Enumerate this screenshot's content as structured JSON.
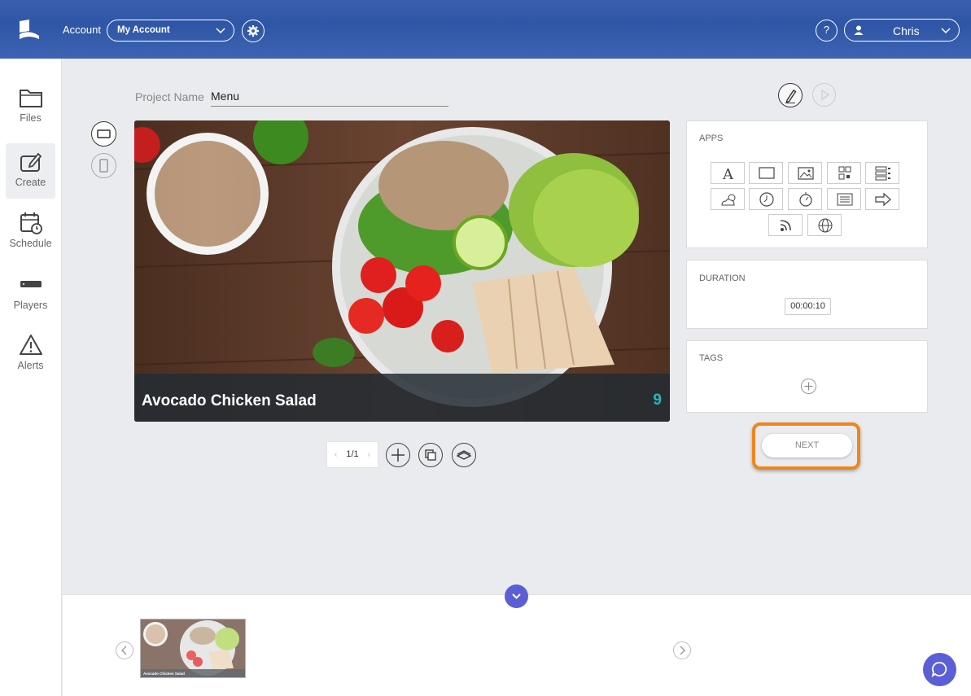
{
  "header": {
    "account_label": "Account",
    "account_value": "My Account",
    "help_label": "?",
    "user_name": "Chris"
  },
  "sidebar": {
    "items": [
      {
        "label": "Files",
        "icon": "folder-icon"
      },
      {
        "label": "Create",
        "icon": "create-icon",
        "active": true
      },
      {
        "label": "Schedule",
        "icon": "calendar-clock-icon"
      },
      {
        "label": "Players",
        "icon": "player-device-icon"
      },
      {
        "label": "Alerts",
        "icon": "alert-triangle-icon"
      }
    ]
  },
  "project": {
    "name_label": "Project Name",
    "name_value": "Menu"
  },
  "canvas": {
    "title": "Avocado Chicken Salad",
    "price": "9"
  },
  "pager": {
    "page": "1/1",
    "prev": "‹",
    "next": "›"
  },
  "panels": {
    "apps_title": "APPS",
    "duration_title": "DURATION",
    "duration_value": "00:00:10",
    "tags_title": "TAGS"
  },
  "apps": [
    "text-icon",
    "rectangle-icon",
    "image-icon",
    "qr-code-icon",
    "list-icon",
    "weather-icon",
    "clock-icon",
    "timer-icon",
    "document-icon",
    "arrow-icon",
    "rss-icon",
    "globe-icon"
  ],
  "next_label": "NEXT",
  "thumbnail": {
    "label": "Avocado Chicken Salad"
  },
  "colors": {
    "accent": "#5b5fd6",
    "highlight": "#f08519",
    "price": "#1fb8c4"
  }
}
